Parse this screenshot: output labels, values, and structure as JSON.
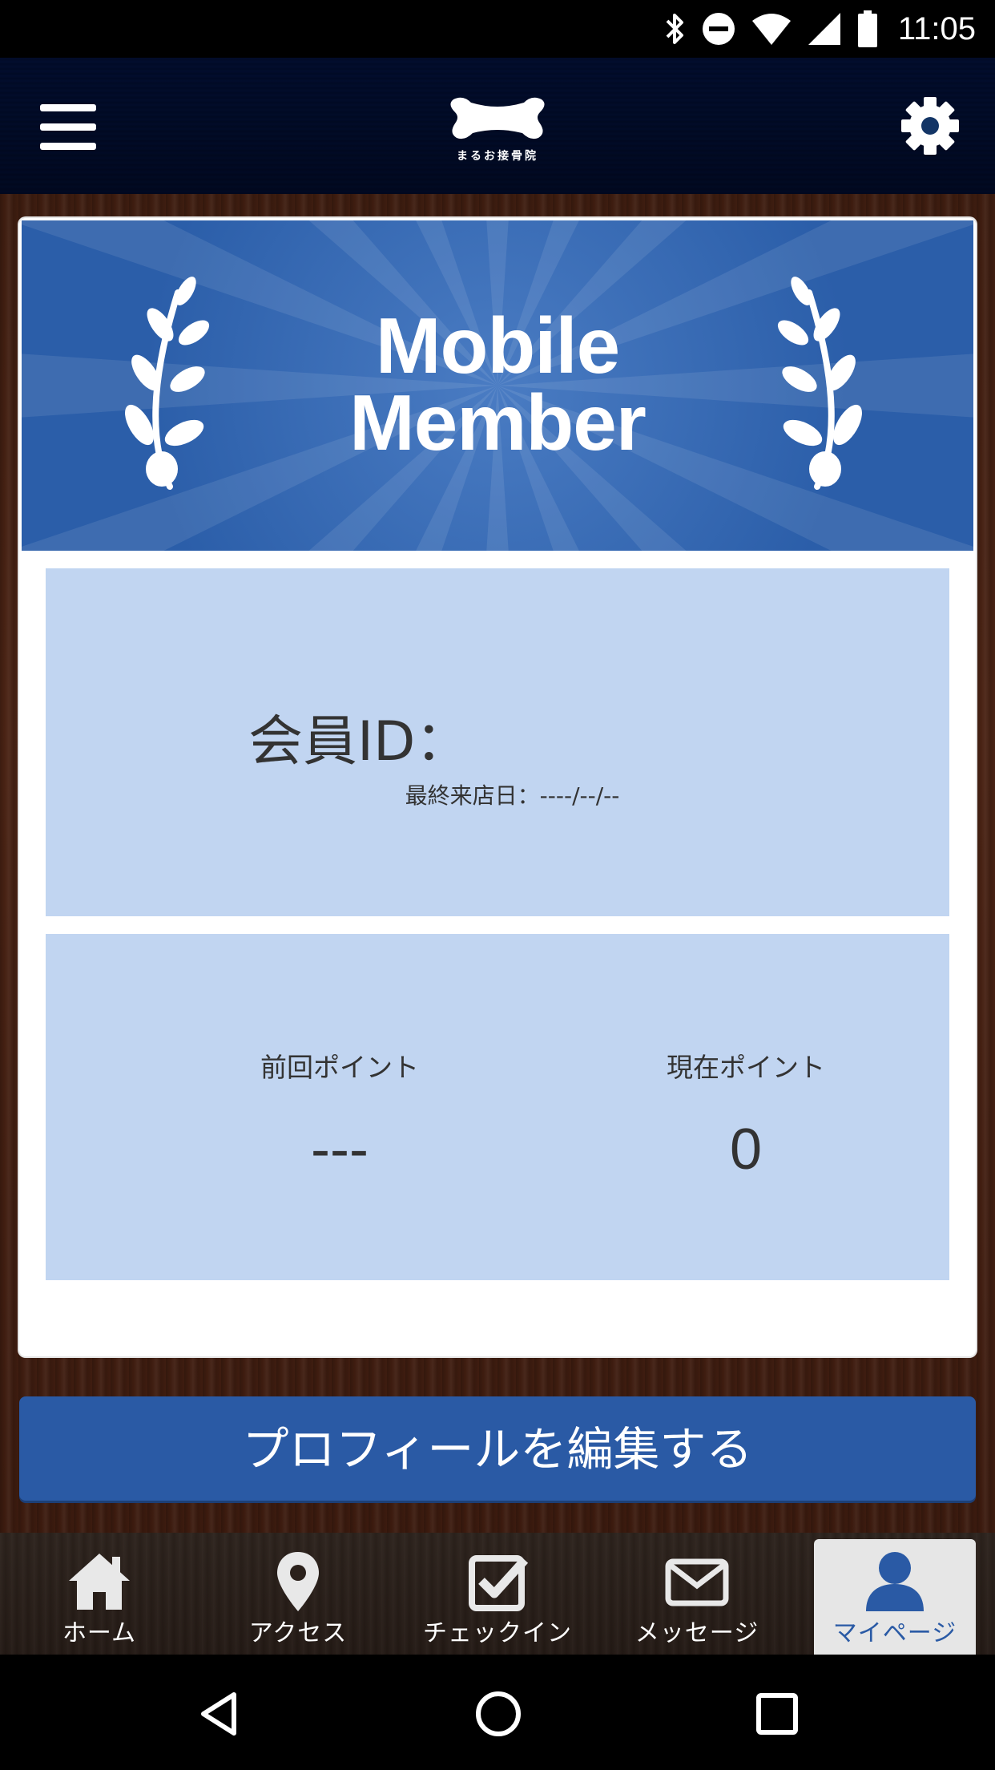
{
  "status_bar": {
    "time": "11:05"
  },
  "header": {
    "logo_text": "まるお接骨院",
    "icons": {
      "menu": "hamburger-menu-icon",
      "settings": "gear-icon",
      "logo": "bone-logo-icon"
    }
  },
  "banner": {
    "line1": "Mobile",
    "line2": "Member"
  },
  "member": {
    "id_label": "会員ID：",
    "last_visit_label": "最終来店日：",
    "last_visit_value": "----/--/--"
  },
  "points": {
    "previous_label": "前回ポイント",
    "previous_value": "---",
    "current_label": "現在ポイント",
    "current_value": "0"
  },
  "edit_button": {
    "label": "プロフィールを編集する"
  },
  "tabs": [
    {
      "label": "ホーム",
      "icon": "home-icon"
    },
    {
      "label": "アクセス",
      "icon": "map-pin-icon"
    },
    {
      "label": "チェックイン",
      "icon": "checkbox-icon"
    },
    {
      "label": "メッセージ",
      "icon": "envelope-icon"
    },
    {
      "label": "マイページ",
      "icon": "user-icon",
      "active": true
    }
  ],
  "colors": {
    "primary_blue": "#2a5aa5",
    "panel_blue": "#c1d5f1",
    "header_navy": "#133566",
    "wood_brown": "#4a2314",
    "tab_active_bg": "#e6e6e6"
  }
}
